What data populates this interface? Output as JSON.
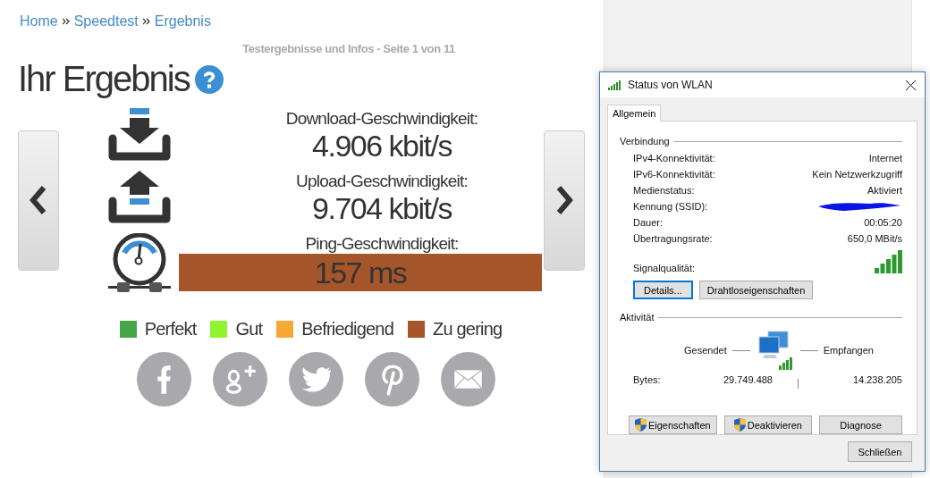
{
  "breadcrumb": [
    {
      "label": "Home"
    },
    {
      "label": "Speedtest"
    },
    {
      "label": "Ergebnis"
    }
  ],
  "subtitle": "Testergebnisse und Infos - Seite 1 von 11",
  "heading": "Ihr Ergebnis",
  "results": [
    {
      "kind": "download",
      "label": "Download-Geschwindigkeit:",
      "value": "4.906 kbit/s"
    },
    {
      "kind": "upload",
      "label": "Upload-Geschwindigkeit:",
      "value": "9.704 kbit/s"
    },
    {
      "kind": "ping",
      "label": "Ping-Geschwindigkeit:",
      "value": "157 ms",
      "color": "#a5552a"
    }
  ],
  "legend": [
    {
      "label": "Perfekt",
      "color": "#44a648"
    },
    {
      "label": "Gut",
      "color": "#8ff531"
    },
    {
      "label": "Befriedigend",
      "color": "#f7a733"
    },
    {
      "label": "Zu gering",
      "color": "#a5552a"
    }
  ],
  "share": [
    {
      "kind": "facebook"
    },
    {
      "kind": "googleplus"
    },
    {
      "kind": "twitter"
    },
    {
      "kind": "pinterest"
    },
    {
      "kind": "email"
    }
  ],
  "dialog": {
    "title": "Status von WLAN",
    "tabs": [
      {
        "label": "Allgemein",
        "selected": true
      }
    ],
    "connection_heading": "Verbindung",
    "rows": [
      {
        "kind": "text",
        "label": "IPv4-Konnektivität:",
        "value": "Internet"
      },
      {
        "kind": "text",
        "label": "IPv6-Konnektivität:",
        "value": "Kein Netzwerkzugriff"
      },
      {
        "kind": "text",
        "label": "Medienstatus:",
        "value": "Aktiviert"
      },
      {
        "kind": "redacted",
        "label": "Kennung (SSID):"
      },
      {
        "kind": "text",
        "label": "Dauer:",
        "value": "00:05:20"
      },
      {
        "kind": "text",
        "label": "Übertragungsrate:",
        "value": "650,0 MBit/s"
      },
      {
        "kind": "signal",
        "label": "Signalqualität:"
      }
    ],
    "connection_buttons": [
      {
        "label": "Details...",
        "focused": true
      },
      {
        "label": "Drahtloseigenschaften",
        "focused": false
      }
    ],
    "activity_heading": "Aktivität",
    "sent_label": "Gesendet",
    "received_label": "Empfangen",
    "bytes_label": "Bytes:",
    "bytes_sent": "29.749.488",
    "bytes_received": "14.238.205",
    "action_buttons": [
      {
        "label": "Eigenschaften",
        "shield": true
      },
      {
        "label": "Deaktivieren",
        "shield": true
      },
      {
        "label": "Diagnose",
        "shield": false
      }
    ],
    "close_button": "Schließen"
  }
}
